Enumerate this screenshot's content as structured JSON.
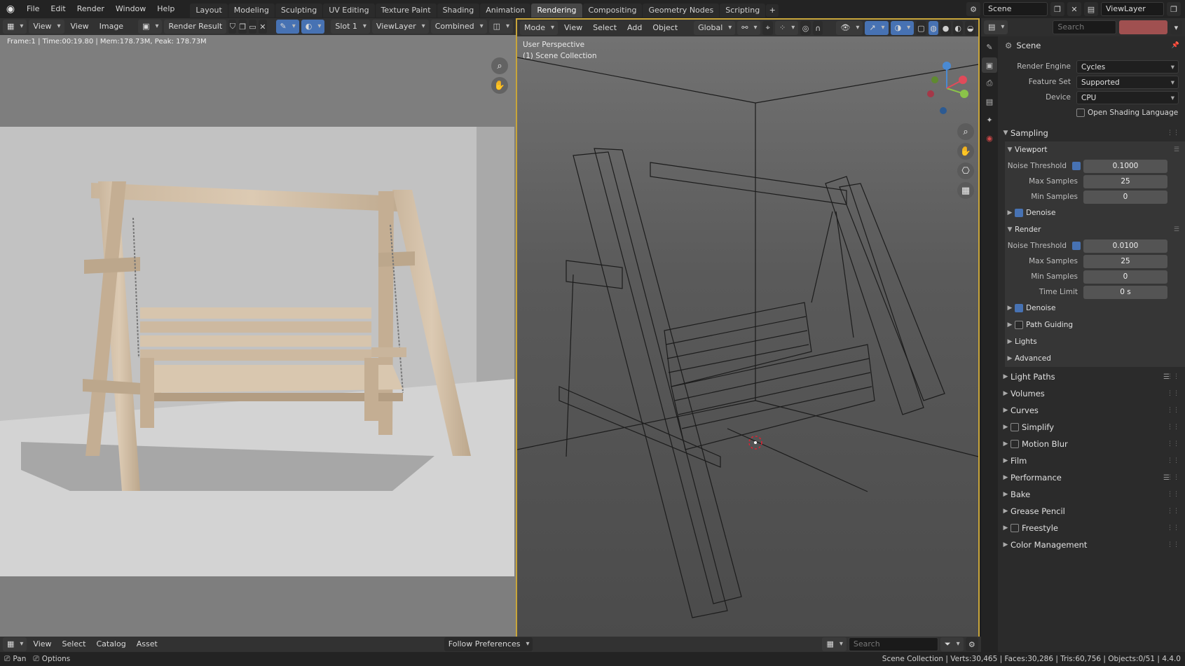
{
  "topbar": {
    "menus": [
      "File",
      "Edit",
      "Render",
      "Window",
      "Help"
    ],
    "tabs": [
      "Layout",
      "Modeling",
      "Sculpting",
      "UV Editing",
      "Texture Paint",
      "Shading",
      "Animation",
      "Rendering",
      "Compositing",
      "Geometry Nodes",
      "Scripting"
    ],
    "active_tab": "Rendering",
    "scene": "Scene",
    "view_layer": "ViewLayer"
  },
  "image_editor": {
    "view": "View",
    "menu_view": "View",
    "menu_image": "Image",
    "image_name": "Render Result",
    "slot": "Slot 1",
    "view_layer": "ViewLayer",
    "pass": "Combined",
    "info": "Frame:1 | Time:00:19.80 | Mem:178.73M, Peak: 178.73M"
  },
  "viewport": {
    "mode": "Mode",
    "menus": [
      "View",
      "Select",
      "Add",
      "Object"
    ],
    "orientation": "Global",
    "perspective": "User Perspective",
    "collection": "(1) Scene Collection"
  },
  "properties": {
    "search_placeholder": "Search",
    "scene_label": "Scene",
    "render_engine_label": "Render Engine",
    "render_engine": "Cycles",
    "feature_set_label": "Feature Set",
    "feature_set": "Supported",
    "device_label": "Device",
    "device": "CPU",
    "osl_label": "Open Shading Language",
    "sampling": "Sampling",
    "viewport_panel": "Viewport",
    "noise_threshold_label": "Noise Threshold",
    "viewport_noise": "0.1000",
    "max_samples_label": "Max Samples",
    "viewport_max": "25",
    "min_samples_label": "Min Samples",
    "viewport_min": "0",
    "denoise": "Denoise",
    "render_panel": "Render",
    "render_noise": "0.0100",
    "render_max": "25",
    "render_min": "0",
    "time_limit_label": "Time Limit",
    "time_limit": "0 s",
    "path_guiding": "Path Guiding",
    "lights": "Lights",
    "advanced": "Advanced",
    "sections": [
      "Light Paths",
      "Volumes",
      "Curves",
      "Simplify",
      "Motion Blur",
      "Film",
      "Performance",
      "Bake",
      "Grease Pencil",
      "Freestyle",
      "Color Management"
    ]
  },
  "bottom": {
    "menus": [
      "View",
      "Select",
      "Catalog",
      "Asset"
    ],
    "library": "Follow Preferences",
    "search_placeholder": "Search"
  },
  "status": {
    "pan": "Pan",
    "options": "Options",
    "stats": "Scene Collection | Verts:30,465 | Faces:30,286 | Tris:60,756 | Objects:0/51 | 4.4.0"
  }
}
